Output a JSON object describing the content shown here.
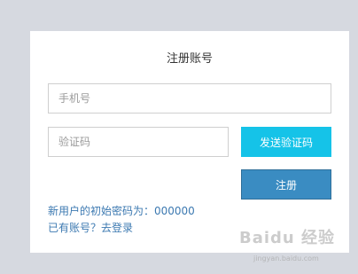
{
  "page": {
    "title": "注册账号"
  },
  "form": {
    "phone_placeholder": "手机号",
    "code_placeholder": "验证码",
    "send_code_label": "发送验证码",
    "register_label": "注册"
  },
  "footer": {
    "password_hint": "新用户的初始密码为：000000",
    "login_link": "已有账号？去登录"
  },
  "watermark": {
    "logo_text": "Baidu 经验",
    "url": "jingyan.baidu.com"
  },
  "colors": {
    "send_button": "#15c3e8",
    "register_button": "#3a8cc2",
    "link_text": "#3c79b1",
    "background": "#d6d9e0"
  }
}
